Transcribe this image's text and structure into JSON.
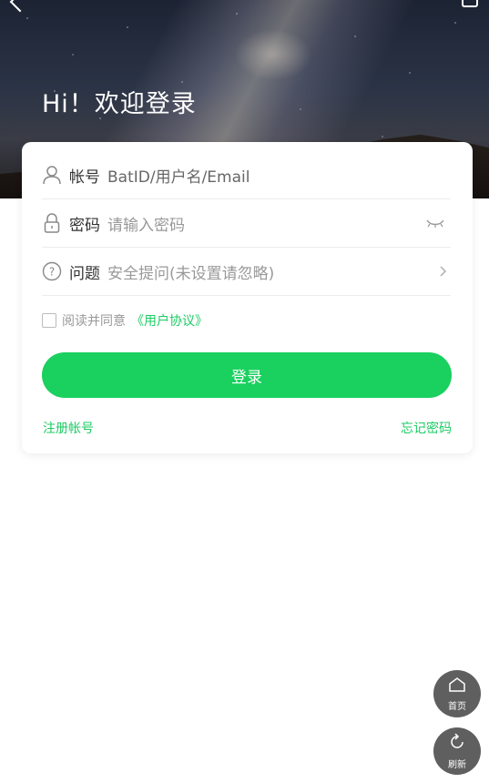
{
  "header": {
    "greeting": "Hi！欢迎登录",
    "back_icon": "back-chevron-icon",
    "share_icon": "share-icon"
  },
  "form": {
    "account": {
      "label": "帐号",
      "value": "BatID/用户名/Email",
      "icon": "user-icon"
    },
    "password": {
      "label": "密码",
      "placeholder": "请输入密码",
      "icon": "lock-icon",
      "toggle_icon": "eye-closed-icon"
    },
    "question": {
      "label": "问题",
      "placeholder": "安全提问(未设置请忽略)",
      "icon": "question-icon",
      "arrow_icon": "chevron-right-icon"
    },
    "agreement": {
      "text": "阅读并同意",
      "link": "《用户协议》",
      "checked": false
    },
    "login_button": "登录",
    "register_link": "注册帐号",
    "forgot_link": "忘记密码"
  },
  "floating": {
    "home_label": "首页",
    "refresh_label": "刷新"
  },
  "colors": {
    "accent": "#1ad05f",
    "link": "#1dcb64",
    "fab": "#5f5f5f"
  }
}
